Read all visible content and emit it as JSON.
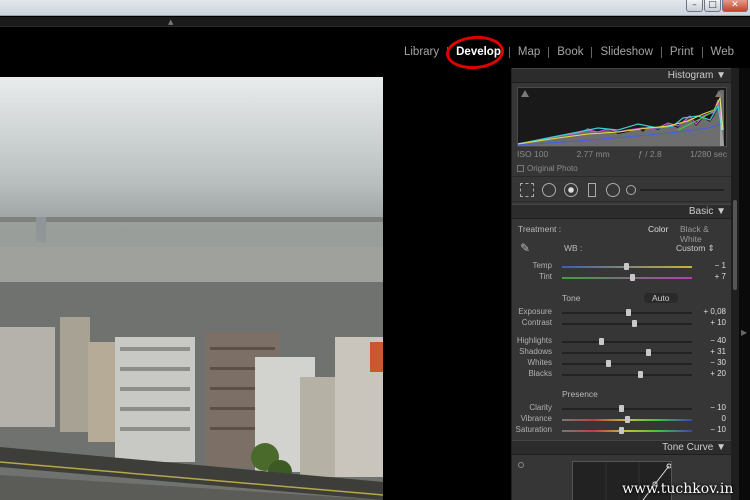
{
  "modules": [
    "Library",
    "Develop",
    "Map",
    "Book",
    "Slideshow",
    "Print",
    "Web"
  ],
  "active_module": "Develop",
  "histogram": {
    "title": "Histogram",
    "iso": "ISO 100",
    "focal": "2.77 mm",
    "aperture": "ƒ / 2.8",
    "shutter": "1/280 sec",
    "original_photo": "Original Photo"
  },
  "basic": {
    "title": "Basic",
    "treatment_label": "Treatment :",
    "color": "Color",
    "bw": "Black & White",
    "wb_label": "WB :",
    "wb_value": "Custom ⇕",
    "tone_label": "Tone",
    "auto": "Auto",
    "presence_label": "Presence",
    "sliders": [
      {
        "label": "Temp",
        "value": "− 1",
        "pos": 0.49
      },
      {
        "label": "Tint",
        "value": "+ 7",
        "pos": 0.54
      },
      {
        "label": "Exposure",
        "value": "+ 0,08",
        "pos": 0.51
      },
      {
        "label": "Contrast",
        "value": "+ 10",
        "pos": 0.55
      },
      {
        "label": "Highlights",
        "value": "− 40",
        "pos": 0.3
      },
      {
        "label": "Shadows",
        "value": "+ 31",
        "pos": 0.66
      },
      {
        "label": "Whites",
        "value": "− 30",
        "pos": 0.35
      },
      {
        "label": "Blacks",
        "value": "+ 20",
        "pos": 0.6
      },
      {
        "label": "Clarity",
        "value": "− 10",
        "pos": 0.45
      },
      {
        "label": "Vibrance",
        "value": "0",
        "pos": 0.5
      },
      {
        "label": "Saturation",
        "value": "− 10",
        "pos": 0.45
      }
    ]
  },
  "tone_curve": {
    "title": "Tone Curve"
  },
  "watermark": "www.tuchkov.in",
  "colors": {
    "highlight_circle": "#e10000",
    "panel_bg": "#363636"
  }
}
